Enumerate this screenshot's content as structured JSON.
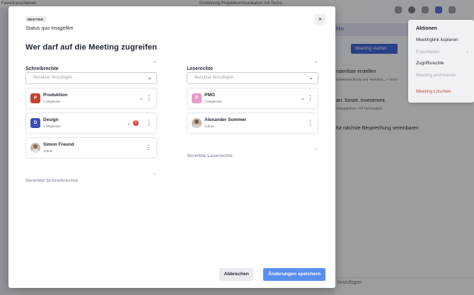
{
  "background": {
    "topbar_left": "Favorit erscheinen",
    "topbar_right": "Einführung Projektkommunikation mit Techo",
    "tab_label": "film",
    "start_button": "Meeting starten",
    "item1_title": "ndenliste erstellen",
    "item1_sub": "duktentwicklung und -einführu... • Vertri",
    "item2_title": "art. Smart. Investment.",
    "item2_sub": "riebspipeline • 04 Verhandeln",
    "item3_title": "für nächste Besprechung vereinbaren",
    "bottom_input": "hinzufügen"
  },
  "menu": {
    "title": "Aktionen",
    "items": [
      {
        "label": "Meetinglink kopieren",
        "state": "normal"
      },
      {
        "label": "Exportieren",
        "state": "disabled"
      },
      {
        "label": "Zugriffsrechte",
        "state": "normal"
      },
      {
        "label": "Meeting archivieren",
        "state": "disabled"
      },
      {
        "label": "Meeting Löschen",
        "state": "danger"
      }
    ]
  },
  "modal": {
    "badge": "MEETING",
    "subtitle": "Status quo Imagefilm",
    "title": "Wer darf auf die Meeting zugreifen",
    "close_icon": "×",
    "write": {
      "heading": "Schreibrechte",
      "placeholder": "Benutzer hinzufügen",
      "entries": [
        {
          "initial": "P",
          "color": "#c2452f",
          "name": "Produktion",
          "meta": "1 Mitglieder",
          "type": "group"
        },
        {
          "initial": "D",
          "color": "#3d4fb8",
          "name": "Design",
          "meta": "4 Mitglieder",
          "type": "group",
          "warning": "!"
        },
        {
          "initial": "",
          "name": "Simon Freund",
          "meta": "Admin",
          "type": "user"
        }
      ],
      "inherited": "Vererbte Schreibrechte"
    },
    "read": {
      "heading": "Leserechte",
      "placeholder": "Benutzer hinzufügen",
      "entries": [
        {
          "initial": "P",
          "color": "#e79bc6",
          "name": "PMO",
          "meta": "3 Mitglieder",
          "type": "group"
        },
        {
          "initial": "",
          "name": "Alexander Sommer",
          "meta": "Admin",
          "type": "user"
        }
      ],
      "inherited": "Vererbte Leserechte"
    },
    "cancel": "Abbrechen",
    "save": "Änderungen speichern"
  }
}
